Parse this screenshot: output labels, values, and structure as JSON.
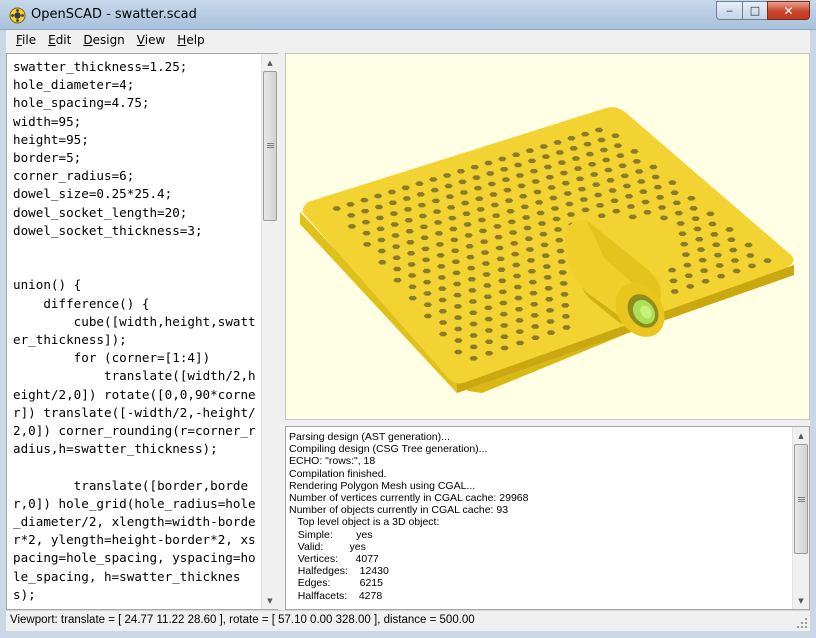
{
  "window": {
    "title": "OpenSCAD - swatter.scad",
    "minimize_symbol": "‒",
    "maximize_symbol": "□",
    "close_symbol": "✕"
  },
  "menu": [
    {
      "first": "F",
      "rest": "ile"
    },
    {
      "first": "E",
      "rest": "dit"
    },
    {
      "first": "D",
      "rest": "esign"
    },
    {
      "first": "V",
      "rest": "iew"
    },
    {
      "first": "H",
      "rest": "elp"
    }
  ],
  "editor": {
    "code": "swatter_thickness=1.25;\nhole_diameter=4;\nhole_spacing=4.75;\nwidth=95;\nheight=95;\nborder=5;\ncorner_radius=6;\ndowel_size=0.25*25.4;\ndowel_socket_length=20;\ndowel_socket_thickness=3;\n\n\nunion() {\n    difference() {\n        cube([width,height,swatter_thickness]);\n        for (corner=[1:4])\n            translate([width/2,height/2,0]) rotate([0,0,90*corner]) translate([-width/2,-height/2,0]) corner_rounding(r=corner_radius,h=swatter_thickness);\n\n        translate([border,border,0]) hole_grid(hole_radius=hole_diameter/2, xlength=width-border*2, ylength=height-border*2, xspacing=hole_spacing, yspacing=hole_spacing, h=swatter_thickness);"
  },
  "viewport": {
    "plate_color": "#f3d331",
    "plate_edge_color": "#d9b813",
    "hole_color": "#8a7a2a",
    "dowel_inner_color": "#a8e05a"
  },
  "console": {
    "lines": [
      "Parsing design (AST generation)...",
      "Compiling design (CSG Tree generation)...",
      "ECHO: \"rows:\", 18",
      "Compilation finished.",
      "Rendering Polygon Mesh using CGAL...",
      "Number of vertices currently in CGAL cache: 29968",
      "Number of objects currently in CGAL cache: 93",
      "   Top level object is a 3D object:",
      "   Simple:        yes",
      "   Valid:         yes",
      "   Vertices:      4077",
      "   Halfedges:    12430",
      "   Edges:          6215",
      "   Halffacets:    4278"
    ]
  },
  "status": {
    "text": "Viewport: translate = [ 24.77 11.22 28.60 ], rotate = [ 57.10 0.00 328.00 ], distance = 500.00"
  }
}
